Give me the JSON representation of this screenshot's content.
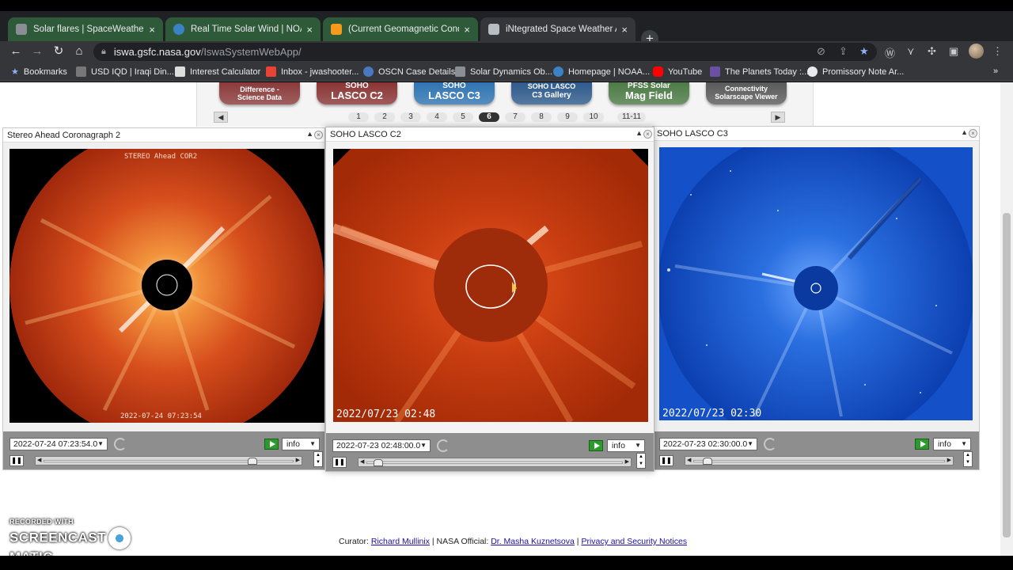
{
  "browser": {
    "tabs": [
      {
        "title": "Solar flares | SpaceWeatherLive.c",
        "state": "inactive"
      },
      {
        "title": "Real Time Solar Wind | NOAA / N",
        "state": "inactive"
      },
      {
        "title": "(Current Geomagnetic Condition",
        "state": "inactive"
      },
      {
        "title": "iNtegrated Space Weather Analy",
        "state": "active"
      }
    ],
    "tab_close": "×",
    "new_tab": "+",
    "url_host": "iswa.gsfc.nasa.gov",
    "url_path": "/IswaSystemWebApp/",
    "bookmarks": [
      "Bookmarks",
      "USD IQD | Iraqi Din...",
      "Interest Calculator",
      "Inbox - jwashooter...",
      "OSCN Case Details",
      "Solar Dynamics Ob...",
      "Homepage | NOAA...",
      "YouTube",
      "The Planets Today :...",
      "Promissory Note Ar..."
    ],
    "bookmarks_overflow": "»"
  },
  "nav_badges": [
    {
      "line1": "Difference -",
      "line2": "Science Data",
      "color": "#8a3a3a"
    },
    {
      "line1": "SOHO",
      "line2": "LASCO C2",
      "color": "#8a3434"
    },
    {
      "line1": "SOHO",
      "line2": "LASCO C3",
      "color": "#2f74b2"
    },
    {
      "line1": "SOHO LASCO",
      "line2": "C3 Gallery",
      "color": "#2e5a8c"
    },
    {
      "line1": "PFSS Solar",
      "line2": "Mag Field",
      "color": "#4c7a45"
    },
    {
      "line1": "Connectivity",
      "line2": "Solarscape Viewer",
      "color": "#5a5a5a"
    }
  ],
  "pages": [
    "1",
    "2",
    "3",
    "4",
    "5",
    "6",
    "7",
    "8",
    "9",
    "10",
    "11-11"
  ],
  "active_page": "6",
  "widgets": [
    {
      "title": "Stereo Ahead Coronagraph 2",
      "date": "2022-07-24 07:23:54.0",
      "info": "info",
      "overlay_top": "STEREO Ahead COR2",
      "overlay_bottom": "2022-07-24 07:23:54",
      "slider_pos": 0.85
    },
    {
      "title": "SOHO LASCO C2",
      "date": "2022-07-23 02:48:00.0",
      "info": "info",
      "overlay_bottom": "2022/07/23 02:48",
      "slider_pos": 0.03
    },
    {
      "title": "SOHO LASCO C3",
      "date": "2022-07-23 02:30:00.0",
      "info": "info",
      "overlay_bottom": "2022/07/23 02:30",
      "slider_pos": 0.04
    }
  ],
  "footer": {
    "curator_label": "Curator:",
    "curator_name": "Richard Mullinix",
    "nasa_label": "| NASA Official:",
    "nasa_name": "Dr. Masha Kuznetsova",
    "privacy": "Privacy and Security Notices"
  },
  "watermark": {
    "top": "RECORDED WITH",
    "left": "SCREENCAST",
    "right": "MATIC"
  },
  "colors": {
    "tab_inactive": "#2f5a3a",
    "tab_active": "#35363a",
    "link": "#1a0dab",
    "cor2": "#e2521e",
    "c2": "#c43b10",
    "c3": "#1e5fd0"
  },
  "icons": {
    "lock": "lock-icon",
    "star": "star-icon",
    "extensions": "puzzle-icon"
  }
}
